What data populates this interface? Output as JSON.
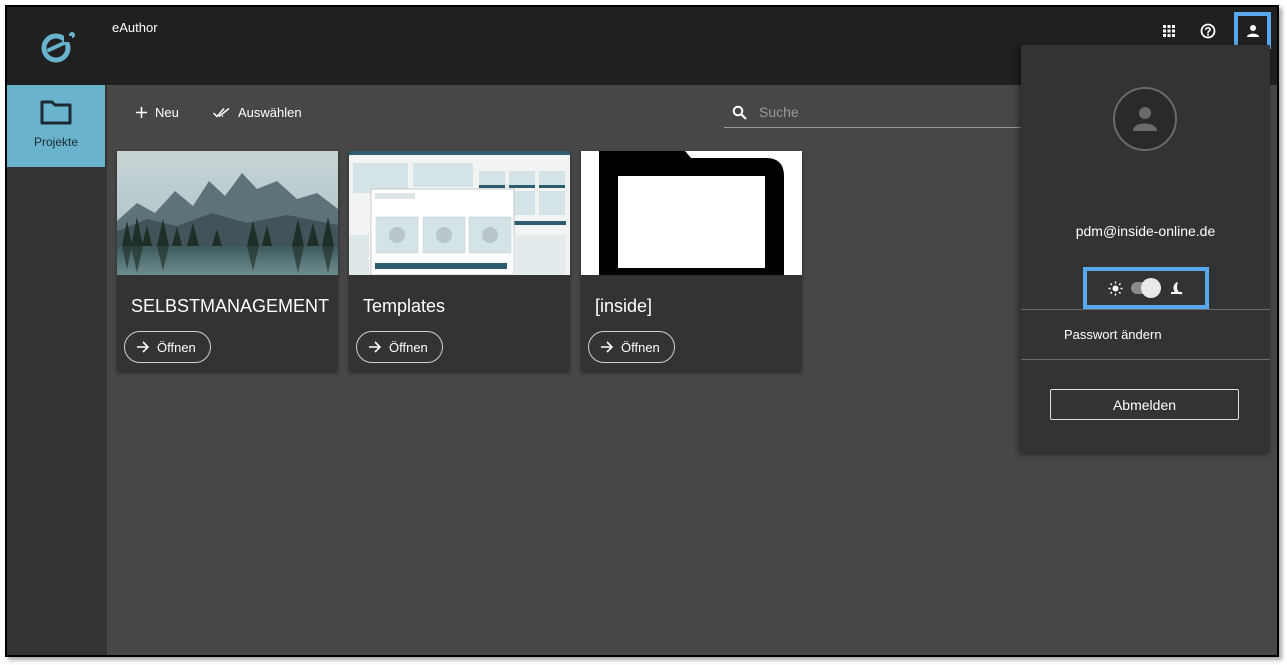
{
  "header": {
    "app_title": "eAuthor",
    "logo_icon": "eauthor-logo-icon",
    "icons": [
      "apps-grid-icon",
      "help-icon",
      "user-icon"
    ]
  },
  "sidebar": {
    "items": [
      {
        "label": "Projekte",
        "icon": "folder-icon",
        "active": true
      }
    ]
  },
  "toolbar": {
    "new_label": "Neu",
    "select_label": "Auswählen"
  },
  "search": {
    "placeholder": "Suche",
    "value": ""
  },
  "projects": [
    {
      "title": "SELBSTMANAGEMENT",
      "open_label": "Öffnen",
      "thumbnail": "mountain-lake-photo"
    },
    {
      "title": "Templates",
      "open_label": "Öffnen",
      "thumbnail": "template-pages-preview"
    },
    {
      "title": "[inside]",
      "open_label": "Öffnen",
      "thumbnail": "folder-outline-icon"
    }
  ],
  "user_menu": {
    "email": "pdm@inside-online.de",
    "change_password_label": "Passwort ändern",
    "logout_label": "Abmelden",
    "theme_toggle": {
      "light_icon": "sun-icon",
      "dark_icon": "moon-icon",
      "state": "light"
    }
  },
  "colors": {
    "header_bg": "#202020",
    "content_bg": "#474747",
    "sidebar_bg": "#333333",
    "active_nav": "#6ab3cd",
    "highlight": "#5aa8ec",
    "logo": "#6ab3cd"
  }
}
